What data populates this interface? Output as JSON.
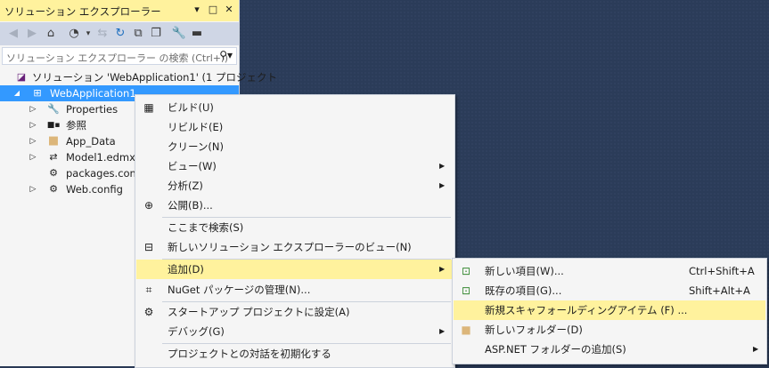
{
  "panel": {
    "title": "ソリューション エクスプローラー",
    "search_placeholder": "ソリューション エクスプローラー の検索 (Ctrl+;)"
  },
  "tree": [
    {
      "label": "ソリューション 'WebApplication1' (1 プロジェクト",
      "icon": "solution-icon",
      "expander": ""
    },
    {
      "label": "WebApplication1",
      "icon": "web-project-icon",
      "expander": "◢",
      "selected": true
    },
    {
      "label": "Properties",
      "icon": "wrench-icon",
      "expander": "▷"
    },
    {
      "label": "参照",
      "icon": "references-icon",
      "expander": "▷"
    },
    {
      "label": "App_Data",
      "icon": "folder-icon",
      "expander": "▷"
    },
    {
      "label": "Model1.edmx",
      "icon": "edmx-icon",
      "expander": "▷"
    },
    {
      "label": "packages.config",
      "icon": "config-file-icon",
      "expander": ""
    },
    {
      "label": "Web.config",
      "icon": "config-file-icon",
      "expander": "▷"
    }
  ],
  "context_menu": [
    {
      "label": "ビルド(U)",
      "icon": "build-icon"
    },
    {
      "label": "リビルド(E)"
    },
    {
      "label": "クリーン(N)"
    },
    {
      "label": "ビュー(W)",
      "submenu": true
    },
    {
      "label": "分析(Z)",
      "submenu": true
    },
    {
      "label": "公開(B)...",
      "icon": "globe-icon"
    },
    {
      "label": "ここまで検索(S)"
    },
    {
      "label": "新しいソリューション エクスプローラーのビュー(N)",
      "icon": "new-view-icon"
    },
    {
      "label": "追加(D)",
      "submenu": true,
      "highlighted": true
    },
    {
      "label": "NuGet パッケージの管理(N)...",
      "icon": "nuget-icon"
    },
    {
      "label": "スタートアップ プロジェクトに設定(A)",
      "icon": "gear-icon"
    },
    {
      "label": "デバッグ(G)",
      "submenu": true
    },
    {
      "label": "プロジェクトとの対話を初期化する"
    }
  ],
  "add_submenu": [
    {
      "label": "新しい項目(W)...",
      "shortcut": "Ctrl+Shift+A",
      "icon": "new-item-icon"
    },
    {
      "label": "既存の項目(G)...",
      "shortcut": "Shift+Alt+A",
      "icon": "existing-item-icon"
    },
    {
      "label": "新規スキャフォールディングアイテム (F) ...",
      "shortcut": "",
      "highlighted": true
    },
    {
      "label": "新しいフォルダー(D)",
      "shortcut": "",
      "icon": "new-folder-icon"
    },
    {
      "label": "ASP.NET フォルダーの追加(S)",
      "shortcut": "",
      "submenu": true
    }
  ]
}
